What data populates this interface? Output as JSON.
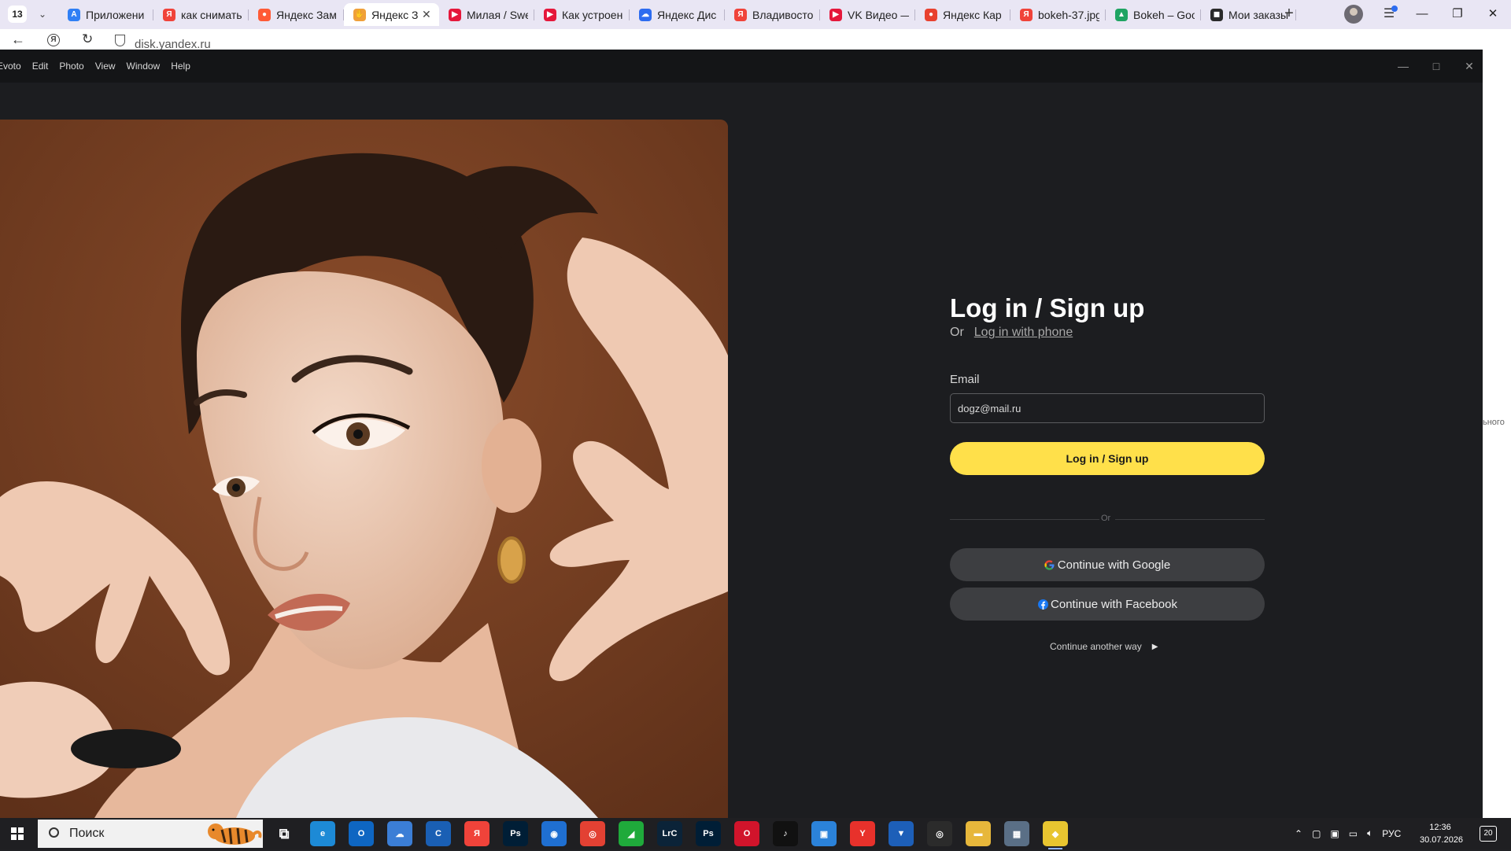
{
  "browser": {
    "tab_count": "13",
    "tabs": [
      {
        "label": "Приложени",
        "icon": "app-store-icon",
        "color": "#2f7ff5",
        "glyph": "A"
      },
      {
        "label": "как снимать",
        "icon": "yandex-icon",
        "color": "#f0433a",
        "glyph": "Я"
      },
      {
        "label": "Яндекс Зам",
        "icon": "yandex-zamechaet-icon",
        "color": "#ff5a36",
        "glyph": "●"
      },
      {
        "label": "Яндекс З",
        "icon": "yandex-zen-hand-icon",
        "color": "#f0a03a",
        "glyph": "✋",
        "active": true
      },
      {
        "label": "Милая / Swe",
        "icon": "youtube-icon",
        "color": "#e5173b",
        "glyph": "▶"
      },
      {
        "label": "Как устроен",
        "icon": "youtube-icon",
        "color": "#e5173b",
        "glyph": "▶"
      },
      {
        "label": "Яндекс Дис",
        "icon": "yandex-disk-icon",
        "color": "#2d6cf0",
        "glyph": "☁"
      },
      {
        "label": "Владивосто",
        "icon": "yandex-icon",
        "color": "#f0433a",
        "glyph": "Я"
      },
      {
        "label": "VK Видео —",
        "icon": "vk-video-icon",
        "color": "#e5173b",
        "glyph": "▶"
      },
      {
        "label": "Яндекс Кар",
        "icon": "yandex-maps-icon",
        "color": "#e8412f",
        "glyph": "●"
      },
      {
        "label": "bokeh-37.jpg",
        "icon": "yandex-icon",
        "color": "#f0433a",
        "glyph": "Я"
      },
      {
        "label": "Bokeh – Goo",
        "icon": "google-drive-icon",
        "color": "#1fa463",
        "glyph": "▲"
      },
      {
        "label": "Мои заказы",
        "icon": "orders-icon",
        "color": "#2a2a2a",
        "glyph": "◼"
      }
    ],
    "address": "disk.yandex.ru"
  },
  "background_page_text": "ьного",
  "app": {
    "menu": [
      "Evoto",
      "Edit",
      "Photo",
      "View",
      "Window",
      "Help"
    ]
  },
  "login": {
    "title": "Log in / Sign up",
    "or": "Or",
    "phone_link": "Log in with phone",
    "email_label": "Email",
    "email_value": "dogz@mail.ru",
    "submit": "Log in / Sign up",
    "divider": "Or",
    "google": "Continue with Google",
    "facebook": "Continue with Facebook",
    "another_way": "Continue another way"
  },
  "colors": {
    "accent_yellow": "#ffe04a",
    "app_bg": "#1c1d20",
    "social_button": "#3d3e41"
  },
  "taskbar": {
    "search": "Поиск",
    "language": "РУС",
    "time": "12:36",
    "date": "30.07.2026",
    "notifications": "20",
    "apps": [
      {
        "name": "task-view-icon",
        "glyph": "⧉",
        "color": "transparent"
      },
      {
        "name": "edge-icon",
        "glyph": "e",
        "color": "#1d8ad6"
      },
      {
        "name": "outlook-icon",
        "glyph": "O",
        "color": "#0e66c2"
      },
      {
        "name": "cloud-app-icon",
        "glyph": "☁",
        "color": "#3b7ed6"
      },
      {
        "name": "ccleaner-icon",
        "glyph": "C",
        "color": "#1a5fb4"
      },
      {
        "name": "yandex-browser-icon",
        "glyph": "Я",
        "color": "#f0433a"
      },
      {
        "name": "photoshop-icon",
        "glyph": "Ps",
        "color": "#001e36"
      },
      {
        "name": "camera-icon",
        "glyph": "◉",
        "color": "#1f6fd1"
      },
      {
        "name": "chrome-icon",
        "glyph": "◎",
        "color": "#e34133"
      },
      {
        "name": "green-app-icon",
        "glyph": "◢",
        "color": "#1faa3b"
      },
      {
        "name": "lightroom-classic-icon",
        "glyph": "LrC",
        "color": "#0b2338"
      },
      {
        "name": "photoshop-2-icon",
        "glyph": "Ps",
        "color": "#001e36"
      },
      {
        "name": "opera-icon",
        "glyph": "O",
        "color": "#d1142b"
      },
      {
        "name": "tiktok-icon",
        "glyph": "♪",
        "color": "#111"
      },
      {
        "name": "phone-link-icon",
        "glyph": "▣",
        "color": "#2b82d9"
      },
      {
        "name": "yandex-icon",
        "glyph": "Y",
        "color": "#e8312b"
      },
      {
        "name": "security-icon",
        "glyph": "▼",
        "color": "#1d5fb8"
      },
      {
        "name": "circle-app-icon",
        "glyph": "◎",
        "color": "#2b2b2b"
      },
      {
        "name": "file-explorer-icon",
        "glyph": "▬",
        "color": "#e7b73b"
      },
      {
        "name": "network-app-icon",
        "glyph": "▦",
        "color": "#5a6f86"
      },
      {
        "name": "evoto-icon",
        "glyph": "◆",
        "color": "#e8c530",
        "active": true
      }
    ]
  }
}
